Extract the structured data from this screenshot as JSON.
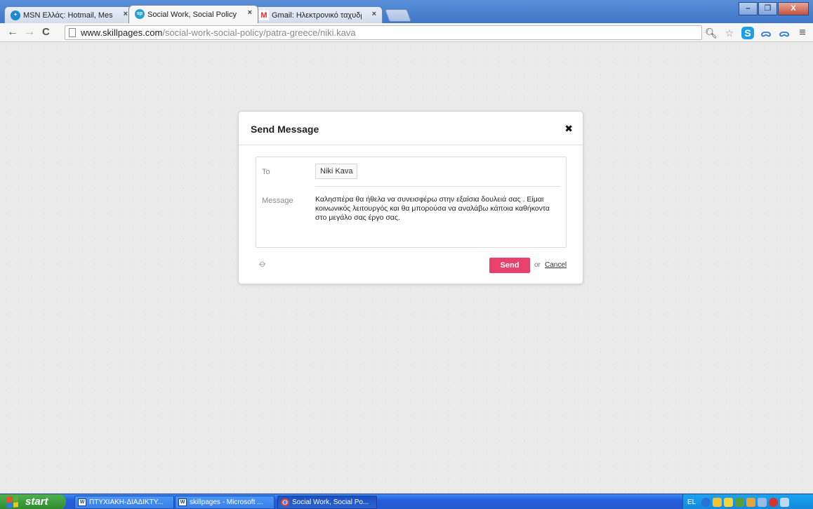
{
  "browser": {
    "tabs": [
      {
        "title": "MSN Ελλάς: Hotmail, Messen",
        "icon": "msn-butterfly-icon",
        "icon_color": "#1e88d0",
        "active": false
      },
      {
        "title": "Social Work, Social Policy - Th",
        "icon": "skillpages-icon",
        "icon_color": "#2a9fd0",
        "active": true
      },
      {
        "title": "Gmail: Ηλεκτρονικό ταχυδρο",
        "icon": "gmail-icon",
        "icon_color": "#d93025",
        "active": false
      }
    ],
    "tab_close_glyph": "×",
    "window_controls": {
      "minimize": "–",
      "restore": "❐",
      "close": "X"
    },
    "nav": {
      "back": "←",
      "forward": "→",
      "reload": "C"
    },
    "url": {
      "domain": "www.skillpages.com",
      "path": "/social-work-social-policy/patra-greece/niki.kava"
    },
    "extensions": [
      "zoom-icon",
      "star-icon",
      "skype-icon",
      "ext-icon",
      "ext-icon"
    ],
    "menu_glyph": "≡"
  },
  "modal": {
    "title": "Send Message",
    "close_glyph": "✖",
    "to_label": "To",
    "to_value": "Niki Kava",
    "message_label": "Message",
    "message_text": "Καλησπέρα θα ήθελα να συνεισφέρω στην εξαίσια δουλειά σας . Είμαι κοινωνικός λειτουργός και θα μπορούσα να αναλάβω κάποια καθήκοντα στο μεγάλο σας έργο σας.",
    "attach_glyph": "📎",
    "send_label": "Send",
    "or_text": "or",
    "cancel_label": "Cancel",
    "accent_color": "#e8426c"
  },
  "taskbar": {
    "start_label": "start",
    "tasks": [
      {
        "label": "ΠΤΥΧΙΑΚΗ-ΔΙΑΔΙΚΤΥ...",
        "icon": "word-icon"
      },
      {
        "label": "skillpages - Microsoft ...",
        "icon": "word-icon"
      },
      {
        "label": "Social Work, Social Po...",
        "icon": "chrome-icon"
      }
    ],
    "language": "EL"
  }
}
